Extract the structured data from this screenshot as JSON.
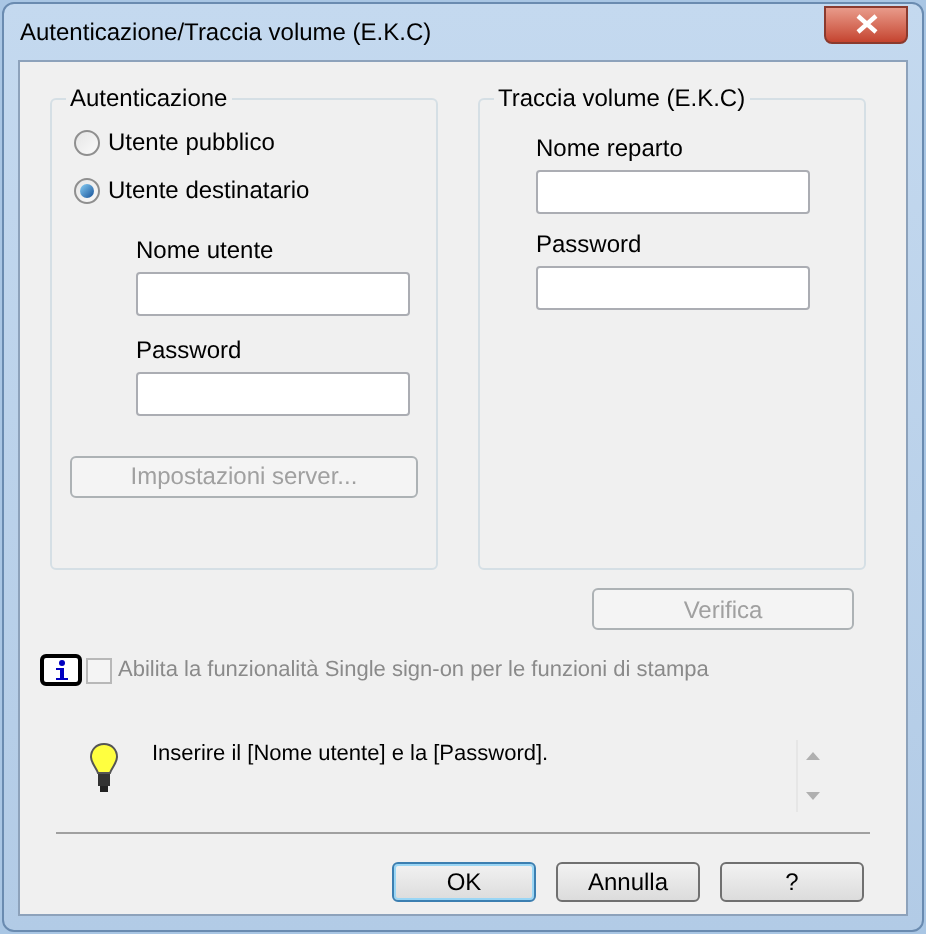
{
  "window": {
    "title": "Autenticazione/Traccia volume (E.K.C)"
  },
  "authentication": {
    "title": "Autenticazione",
    "options": [
      {
        "label": "Utente pubblico",
        "selected": false
      },
      {
        "label": "Utente destinatario",
        "selected": true
      }
    ],
    "fields": [
      {
        "label": "Nome utente"
      },
      {
        "label": "Password"
      }
    ],
    "server_button": {
      "label": "Impostazioni server...",
      "disabled": true
    }
  },
  "account_track": {
    "title": "Traccia volume (E.K.C)",
    "fields": [
      {
        "label": "Nome reparto"
      },
      {
        "label": "Password"
      }
    ]
  },
  "verify_button": {
    "label": "Verifica",
    "disabled": true
  },
  "single_sign_on": {
    "label": "Abilita la funzionalità Single sign-on per le funzioni di stampa",
    "checked": false,
    "disabled": true
  },
  "hint": {
    "text": "Inserire il [Nome utente] e la [Password]."
  },
  "buttons": [
    {
      "label": "OK",
      "kind": "default"
    },
    {
      "label": "Annulla",
      "kind": "normal"
    },
    {
      "label": "?",
      "kind": "normal"
    }
  ]
}
